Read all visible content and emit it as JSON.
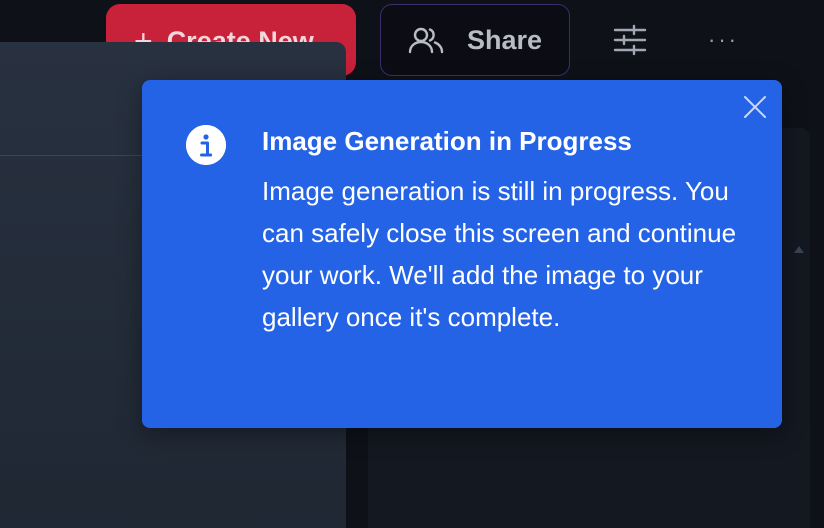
{
  "toolbar": {
    "create_label": "Create New",
    "share_label": "Share",
    "more_label": "···",
    "icons": {
      "create": "plus-icon",
      "share": "users-icon",
      "filters": "sliders-icon",
      "more": "more-horizontal-icon"
    }
  },
  "toast": {
    "title": "Image Generation in Progress",
    "message": "Image generation is still in progress. You can safely close this screen and continue your work. We'll add the image to your gallery once it's complete.",
    "icon": "info-icon",
    "close_icon": "close-icon",
    "background": "#2563e6"
  },
  "colors": {
    "create_button": "#c8213a",
    "share_border": "#3b2f6a",
    "page_background": "#0e1118",
    "side_panel": "#283140"
  }
}
